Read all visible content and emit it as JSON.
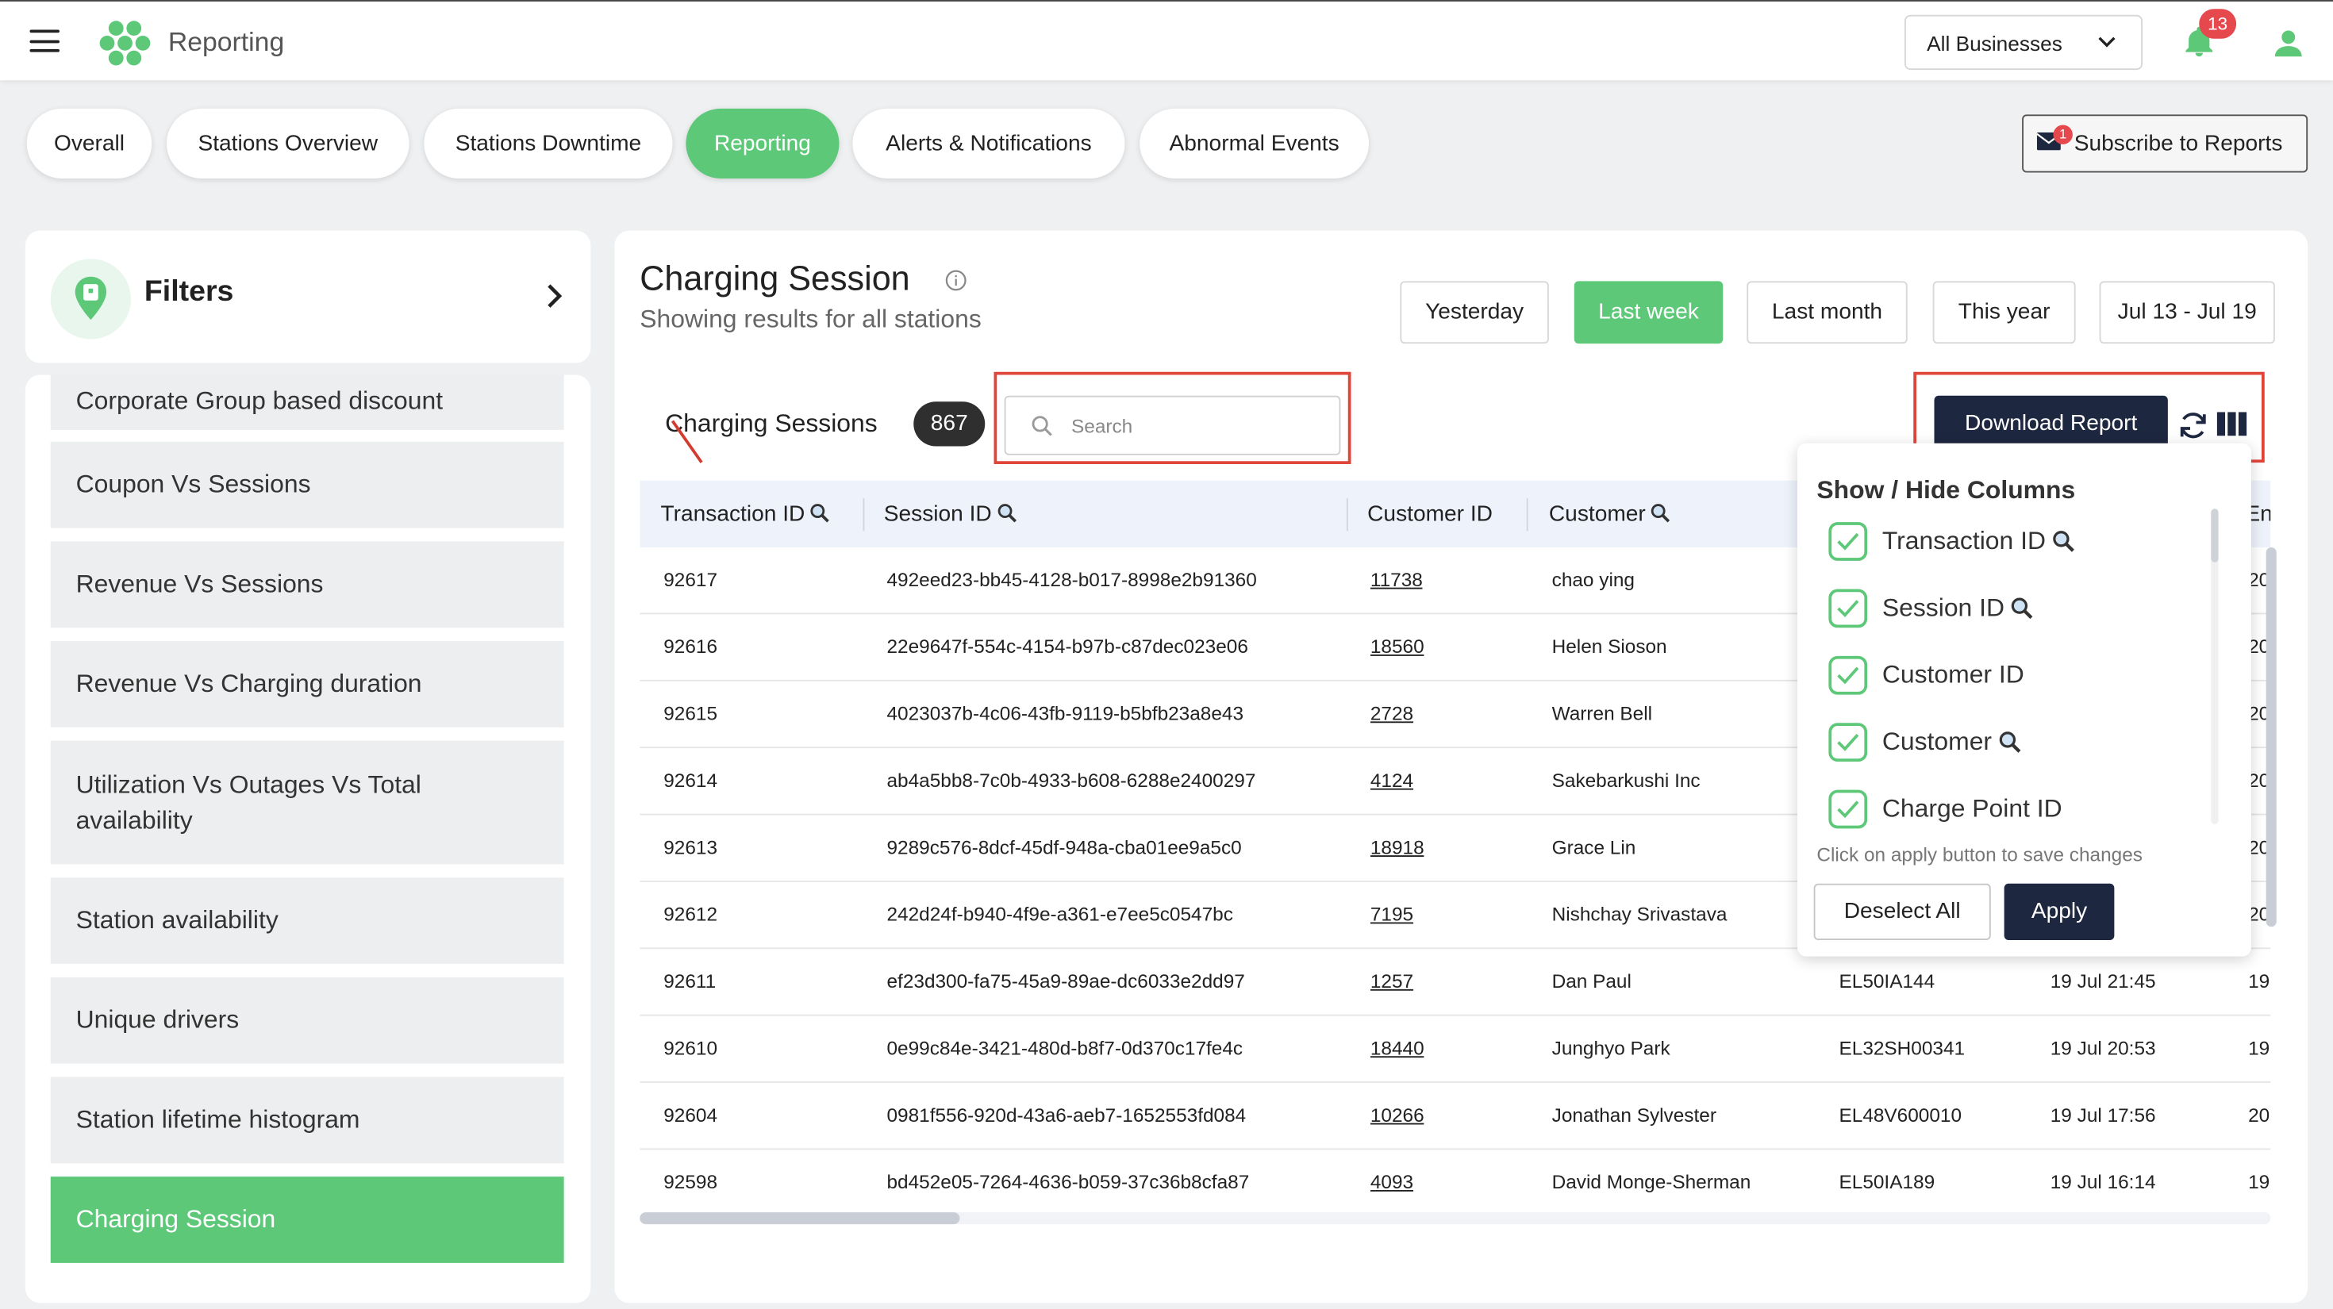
{
  "app": {
    "title": "Reporting",
    "business_select": "All Businesses",
    "notification_count": "13"
  },
  "tabs": [
    {
      "label": "Overall"
    },
    {
      "label": "Stations Overview"
    },
    {
      "label": "Stations Downtime"
    },
    {
      "label": "Reporting",
      "active": true
    },
    {
      "label": "Alerts & Notifications"
    },
    {
      "label": "Abnormal Events"
    }
  ],
  "subscribe": {
    "label": "Subscribe to Reports",
    "badge": "1"
  },
  "filters": {
    "title": "Filters"
  },
  "sidebar": {
    "items": [
      {
        "label": "Corporate Group based discount"
      },
      {
        "label": "Coupon Vs Sessions"
      },
      {
        "label": "Revenue Vs Sessions"
      },
      {
        "label": "Revenue Vs Charging duration"
      },
      {
        "label": "Utilization Vs Outages Vs Total availability"
      },
      {
        "label": "Station availability"
      },
      {
        "label": "Unique drivers"
      },
      {
        "label": "Station lifetime histogram"
      },
      {
        "label": "Charging Session",
        "active": true
      }
    ]
  },
  "main": {
    "title": "Charging Session",
    "subtitle": "Showing results for all stations",
    "periods": [
      {
        "label": "Yesterday"
      },
      {
        "label": "Last week",
        "active": true
      },
      {
        "label": "Last month"
      },
      {
        "label": "This year"
      },
      {
        "label": "Jul 13 - Jul 19"
      }
    ],
    "sessions_label": "Charging Sessions",
    "sessions_count": "867",
    "search_placeholder": "Search",
    "download_label": "Download Report"
  },
  "table": {
    "headers": [
      "Transaction ID",
      "Session ID",
      "Customer ID",
      "Customer",
      "End"
    ],
    "rows": [
      {
        "txn": "92617",
        "session": "492eed23-bb45-4128-b017-8998e2b91360",
        "cust_id": "11738",
        "customer": "chao ying",
        "cp": "",
        "end": "",
        "end2": "20"
      },
      {
        "txn": "92616",
        "session": "22e9647f-554c-4154-b97b-c87dec023e06",
        "cust_id": "18560",
        "customer": "Helen Sioson",
        "cp": "",
        "end": "",
        "end2": "20"
      },
      {
        "txn": "92615",
        "session": "4023037b-4c06-43fb-9119-b5bfb23a8e43",
        "cust_id": "2728",
        "customer": "Warren Bell",
        "cp": "",
        "end": "",
        "end2": "20"
      },
      {
        "txn": "92614",
        "session": "ab4a5bb8-7c0b-4933-b608-6288e2400297",
        "cust_id": "4124",
        "customer": "Sakebarkushi Inc",
        "cp": "",
        "end": "",
        "end2": "20"
      },
      {
        "txn": "92613",
        "session": "9289c576-8dcf-45df-948a-cba01ee9a5c0",
        "cust_id": "18918",
        "customer": "Grace Lin",
        "cp": "",
        "end": "",
        "end2": "20"
      },
      {
        "txn": "92612",
        "session": "242d24f-b940-4f9e-a361-e7ee5c0547bc",
        "cust_id": "7195",
        "customer": "Nishchay Srivastava",
        "cp": "",
        "end": "",
        "end2": "20"
      },
      {
        "txn": "92611",
        "session": "ef23d300-fa75-45a9-89ae-dc6033e2dd97",
        "cust_id": "1257",
        "customer": "Dan Paul",
        "cp": "EL50IA144",
        "end": "19 Jul 21:45",
        "end2": "19"
      },
      {
        "txn": "92610",
        "session": "0e99c84e-3421-480d-b8f7-0d370c17fe4c",
        "cust_id": "18440",
        "customer": "Junghyo Park",
        "cp": "EL32SH00341",
        "end": "19 Jul 20:53",
        "end2": "19"
      },
      {
        "txn": "92604",
        "session": "0981f556-920d-43a6-aeb7-1652553fd084",
        "cust_id": "10266",
        "customer": "Jonathan Sylvester",
        "cp": "EL48V600010",
        "end": "19 Jul 17:56",
        "end2": "20"
      },
      {
        "txn": "92598",
        "session": "bd452e05-7264-4636-b059-37c36b8cfa87",
        "cust_id": "4093",
        "customer": "David Monge-Sherman",
        "cp": "EL50IA189",
        "end": "19 Jul 16:14",
        "end2": "19"
      }
    ]
  },
  "columns_popover": {
    "title": "Show / Hide Columns",
    "items": [
      "Transaction ID",
      "Session ID",
      "Customer ID",
      "Customer",
      "Charge Point ID"
    ],
    "hint": "Click on apply button to save changes",
    "deselect_label": "Deselect All",
    "apply_label": "Apply"
  },
  "colors": {
    "accent": "#5cc878",
    "dark": "#1e2740",
    "danger": "#e5484d",
    "highlight": "#e0453a"
  }
}
